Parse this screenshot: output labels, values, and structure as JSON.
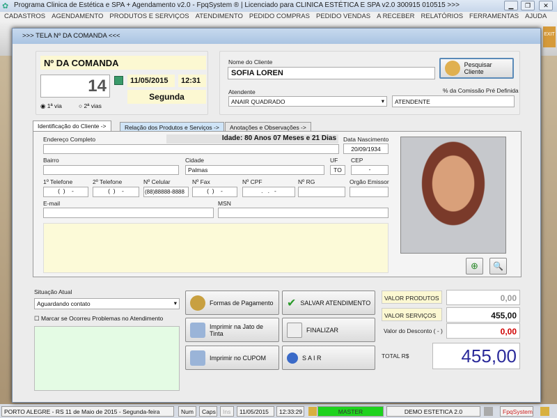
{
  "window": {
    "title": "Programa Clinica de Estética e SPA + Agendamento v2.0 - FpqSystem ® | Licenciado para  CLINICA ESTÉTICA E SPA v2.0 300915 010515 >>>",
    "minimize": "▁",
    "maximize": "❐",
    "close": "✕"
  },
  "menu": [
    "CADASTROS",
    "AGENDAMENTO",
    "PRODUTOS E SERVIÇOS",
    "ATENDIMENTO",
    "PEDIDO COMPRAS",
    "PEDIDO VENDAS",
    "A RECEBER",
    "RELATÓRIOS",
    "FERRAMENTAS",
    "AJUDA"
  ],
  "exit_label": "EXIT",
  "dialog": {
    "title": ">>>   TELA Nº DA COMANDA   <<<"
  },
  "comanda": {
    "label": "Nº DA COMANDA",
    "number": "14",
    "date": "11/05/2015",
    "time": "12:31",
    "weekday": "Segunda",
    "via1": "1ª via",
    "via2": "2ª vias"
  },
  "client": {
    "name_label": "Nome do Cliente",
    "name": "SOFIA LOREN",
    "search_button": "Pesquisar Cliente",
    "attendant_label": "Atendente",
    "attendant": "ANAIR QUADRADO",
    "commission_label": "% da Comissão Pré Definida",
    "commission_value": "ATENDENTE"
  },
  "tabs": [
    "Identificação do Cliente ->",
    "Relação dos Produtos e Serviços ->",
    "Anotações e Observações ->"
  ],
  "form": {
    "address_label": "Endereço Completo",
    "age": "Idade: 80 Anos 07 Meses e 21 Dias",
    "birth_label": "Data Nascimento",
    "birth": "20/09/1934",
    "bairro_label": "Bairro",
    "cidade_label": "Cidade",
    "cidade": "Palmas",
    "uf_label": "UF",
    "uf": "TO",
    "cep_label": "CEP",
    "cep": "-",
    "tel1_label": "1º Telefone",
    "tel1": "(  )    -",
    "tel2_label": "2º Telefone",
    "tel2": "(  )    -",
    "cel_label": "Nº Celular",
    "cel": "(88)88888-8888",
    "fax_label": "Nº Fax",
    "fax": "(  )    -",
    "cpf_label": "Nº CPF",
    "cpf": ".   .   -",
    "rg_label": "Nº RG",
    "emissor_label": "Orgão Emissor",
    "email_label": "E-mail",
    "msn_label": "MSN"
  },
  "status": {
    "label": "Situação Atual",
    "value": "Aguardando contato",
    "problem_label": "Marcar se Ocorreu Problemas no Atendimento"
  },
  "buttons": {
    "payment": "Formas de Pagamento",
    "save": "SALVAR ATENDIMENTO",
    "print_inkjet": "Imprimir na Jato de Tinta",
    "finalize": "FINALIZAR",
    "print_coupon": "Imprimir no CUPOM",
    "exit": "S A I R"
  },
  "totals": {
    "products_label": "VALOR PRODUTOS",
    "products": "0,00",
    "services_label": "VALOR SERVIÇOS",
    "services": "455,00",
    "discount_label": "Valor do Desconto ( - )",
    "discount": "0,00",
    "total_label": "TOTAL R$",
    "total": "455,00"
  },
  "statusbar": {
    "location": "PORTO ALEGRE - RS 11 de Maio de 2015 - Segunda-feira",
    "num": "Num",
    "caps": "Caps",
    "ins": "Ins",
    "date": "11/05/2015",
    "time": "12:33:29",
    "user": "MASTER",
    "company": "DEMO ESTETICA 2.0",
    "brand": "FpqSystem"
  },
  "colors": {
    "accent": "#2a2a9a",
    "discount": "#d00000",
    "master": "#1ed21e"
  }
}
